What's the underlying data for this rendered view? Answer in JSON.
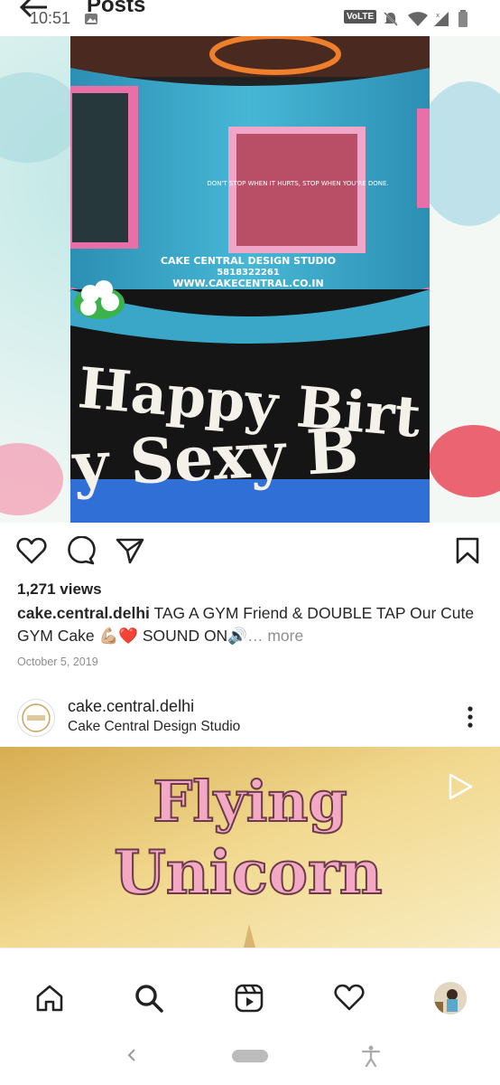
{
  "status_bar": {
    "time": "10:51",
    "volte_label": "VoLTE"
  },
  "header": {
    "title": "Posts"
  },
  "post": {
    "views": "1,271 views",
    "username": "cake.central.delhi",
    "caption": "TAG A GYM Friend & DOUBLE TAP Our Cute GYM  Cake 💪🏼❤️ SOUND ON🔊",
    "more_label": "… more",
    "date": "October 5, 2019",
    "image_texts": {
      "watermark_line1": "CAKE CENTRAL DESIGN STUDIO",
      "watermark_line2": "5818322261",
      "watermark_line3": "WWW.CAKECENTRAL.CO.IN",
      "happy": "Happy Birt",
      "sexy": "y Sexy B",
      "frame_quote": "DON'T STOP WHEN IT HURTS, STOP WHEN YOU'RE DONE."
    }
  },
  "next_post": {
    "username": "cake.central.delhi",
    "subtitle": "Cake Central Design Studio",
    "image_title_line1": "Flying",
    "image_title_line2": "Unicorn"
  },
  "nav": {
    "home": "home-icon",
    "search": "search-icon",
    "reels": "reels-icon",
    "activity": "heart-icon",
    "profile": "profile-avatar"
  },
  "colors": {
    "cake_blue": "#3aa6c8",
    "cake_pink": "#e86fa8",
    "cake_black": "#1a1a1a",
    "unicorn_bg": "#e8c46a",
    "unicorn_text": "#f3a9c4"
  }
}
